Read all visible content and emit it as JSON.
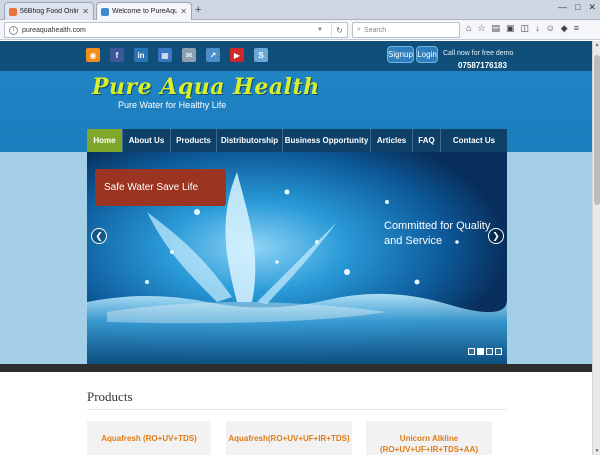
{
  "browser": {
    "tabs": [
      {
        "title": "56Bhog Food Online Food ...",
        "favicon_color": "#e8733a"
      },
      {
        "title": "Welcome to PureAquaHealth.c...",
        "favicon_color": "#3a8ed0"
      }
    ],
    "new_tab_icon": "plus-icon",
    "url": "pureaquahealth.com",
    "search_placeholder": "Search",
    "window_controls": [
      "—",
      "□",
      "✕"
    ]
  },
  "site": {
    "social_icons": [
      {
        "name": "rss-icon",
        "glyph": "◉",
        "color": "#f28c1a"
      },
      {
        "name": "facebook-icon",
        "glyph": "f",
        "color": "#3b5998"
      },
      {
        "name": "linkedin-icon",
        "glyph": "in",
        "color": "#2b74b6"
      },
      {
        "name": "delicious-icon",
        "glyph": "▦",
        "color": "#3a76c1"
      },
      {
        "name": "email-icon",
        "glyph": "✉",
        "color": "#8fa0b2"
      },
      {
        "name": "share-icon",
        "glyph": "↗",
        "color": "#4d8fc9"
      },
      {
        "name": "youtube-icon",
        "glyph": "▶",
        "color": "#cc2a2a"
      },
      {
        "name": "skype-icon",
        "glyph": "S",
        "color": "#6aa8d8"
      }
    ],
    "signup_label": "Signup",
    "login_label": "Login",
    "call_text": "Call now for free demo",
    "phone": "07587176183",
    "logo_text": "Pure Aqua Health",
    "tagline": "Pure Water for Healthy Life",
    "menu": [
      {
        "label": "Home",
        "active": true
      },
      {
        "label": "About Us",
        "active": false
      },
      {
        "label": "Products",
        "active": false
      },
      {
        "label": "Distributorship",
        "active": false
      },
      {
        "label": "Business Opportunity",
        "active": false
      },
      {
        "label": "Articles",
        "active": false
      },
      {
        "label": "FAQ",
        "active": false
      },
      {
        "label": "Contact Us",
        "active": false
      }
    ],
    "slider": {
      "caption_left": "Safe Water Save Life",
      "caption_right": "Committed for Quality and Service",
      "prev_icon": "chevron-left-icon",
      "next_icon": "chevron-right-icon",
      "dots": [
        false,
        true,
        false,
        false
      ]
    },
    "products_title": "Products",
    "products": [
      "Aquafresh (RO+UV+TDS)",
      "Aquafresh(RO+UV+UF+IR+TDS)",
      "Unicorn Alkline (RO+UV+UF+IR+TDS+AA)"
    ]
  },
  "colors": {
    "header_blue": "#1f83c3",
    "nav_dark": "#0e4068",
    "menu_active": "#7fa82a",
    "logo_yellow": "#d8ef2a",
    "product_orange": "#e17b16"
  }
}
